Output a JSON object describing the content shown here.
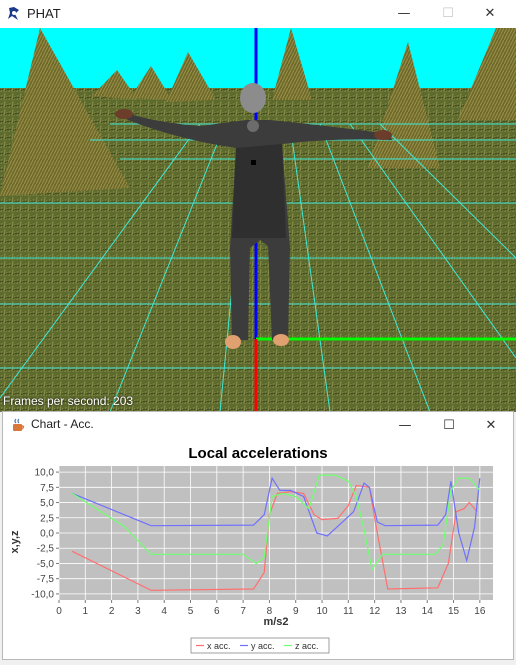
{
  "main_window": {
    "title": "PHAT",
    "fps_label": "Frames per second: 203"
  },
  "controls": {
    "minimize": "—",
    "maximize": "☐",
    "close": "✕"
  },
  "chart_window": {
    "title": "Chart - Acc."
  },
  "colors": {
    "sky": "#00ffff",
    "grid": "#3fe8d6",
    "axis_y": "#0000ff",
    "axis_x": "#00ff00",
    "axis_z": "#ff0000",
    "plot_bg": "#c0c0c0",
    "plot_grid": "#ffffff",
    "x_series": "#ff6f6f",
    "y_series": "#7070ff",
    "z_series": "#6fff6f"
  },
  "chart_data": {
    "type": "line",
    "title": "Local accelerations",
    "xlabel": "m/s2",
    "ylabel": "x,y,z",
    "xlim": [
      0,
      16.5
    ],
    "ylim": [
      -11,
      11
    ],
    "xticks": [
      0,
      1,
      2,
      3,
      4,
      5,
      6,
      7,
      8,
      9,
      10,
      11,
      12,
      13,
      14,
      15,
      16
    ],
    "yticks": [
      -10.0,
      -7.5,
      -5.0,
      -2.5,
      0.0,
      2.5,
      5.0,
      7.5,
      10.0
    ],
    "ytick_labels": [
      "-10,0",
      "-7,5",
      "-5,0",
      "-2,5",
      "0,0",
      "2,5",
      "5,0",
      "7,5",
      "10,0"
    ],
    "legend_position": "bottom",
    "series": [
      {
        "name": "x acc.",
        "color": "#ff6f6f",
        "x": [
          0.5,
          3.5,
          7.4,
          7.8,
          8.0,
          8.3,
          8.8,
          9.3,
          9.7,
          10.0,
          10.6,
          11.0,
          11.3,
          11.8,
          12.1,
          12.5,
          14.4,
          14.8,
          15.1,
          15.4,
          15.6,
          15.9
        ],
        "y": [
          -3.0,
          -9.4,
          -9.2,
          -6.5,
          3.0,
          6.5,
          6.8,
          6.5,
          3.0,
          2.2,
          2.4,
          4.5,
          7.8,
          7.5,
          0.0,
          -9.2,
          -9.0,
          -5.0,
          3.5,
          4.0,
          5.0,
          3.5
        ]
      },
      {
        "name": "y acc.",
        "color": "#7070ff",
        "x": [
          0.5,
          3.5,
          7.4,
          7.8,
          8.1,
          8.4,
          8.8,
          9.3,
          9.8,
          10.2,
          10.7,
          11.2,
          11.6,
          11.8,
          12.1,
          12.4,
          14.4,
          14.7,
          14.9,
          15.2,
          15.5,
          15.8,
          16.0
        ],
        "y": [
          6.5,
          1.2,
          1.3,
          3.0,
          9.0,
          7.0,
          7.0,
          6.0,
          0.0,
          -0.5,
          1.5,
          3.5,
          8.2,
          7.5,
          1.8,
          1.2,
          1.3,
          3.0,
          8.5,
          0.0,
          -4.5,
          1.0,
          9.0
        ]
      },
      {
        "name": "z acc.",
        "color": "#6fff6f",
        "x": [
          0.5,
          2.5,
          3.5,
          7.0,
          7.5,
          7.8,
          8.1,
          8.5,
          9.0,
          9.5,
          9.9,
          10.5,
          11.0,
          11.3,
          11.6,
          11.9,
          12.3,
          14.3,
          14.6,
          14.9,
          15.2,
          15.6,
          16.0
        ],
        "y": [
          6.5,
          1.0,
          -3.5,
          -3.5,
          -5.0,
          -4.0,
          6.0,
          6.5,
          6.0,
          4.0,
          9.5,
          9.5,
          8.5,
          6.0,
          0.5,
          -6.0,
          -3.5,
          -3.5,
          -2.0,
          7.0,
          9.0,
          9.0,
          7.0
        ]
      }
    ]
  }
}
